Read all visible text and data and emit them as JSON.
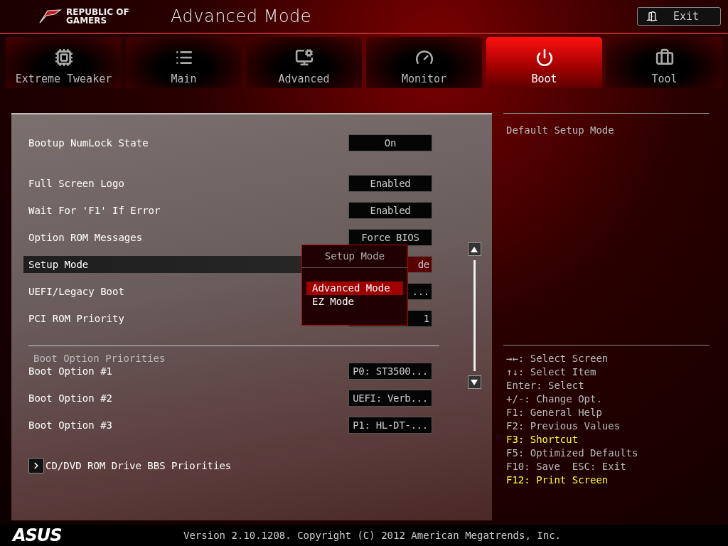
{
  "header": {
    "brand": "REPUBLIC OF GAMERS",
    "title": "Advanced Mode",
    "exit_button": "Exit"
  },
  "tabs": [
    {
      "label": "Extreme Tweaker",
      "selected": false
    },
    {
      "label": "Main",
      "selected": false
    },
    {
      "label": "Advanced",
      "selected": false
    },
    {
      "label": "Monitor",
      "selected": false
    },
    {
      "label": "Boot",
      "selected": true
    },
    {
      "label": "Tool",
      "selected": false
    }
  ],
  "settings": {
    "groups": [
      {
        "items": [
          {
            "kind": "option",
            "label": "Bootup NumLock State",
            "value": "On",
            "selected": false
          }
        ]
      },
      {
        "items": [
          {
            "kind": "option",
            "label": "Full Screen Logo",
            "value": "Enabled",
            "selected": false
          },
          {
            "kind": "option",
            "label": "Wait For 'F1' If Error",
            "value": "Enabled",
            "selected": false
          },
          {
            "kind": "option",
            "label": "Option ROM Messages",
            "value": "Force BIOS",
            "selected": false
          },
          {
            "kind": "option",
            "label": "Setup Mode",
            "value": "de",
            "selected": true,
            "covered": true
          },
          {
            "kind": "option",
            "label": "UEFI/Legacy Boot",
            "value": "...",
            "selected": false,
            "covered": true
          },
          {
            "kind": "option",
            "label": "PCI ROM Priority",
            "value": "1",
            "selected": false,
            "covered": true
          }
        ]
      },
      {
        "heading": "Boot Option Priorities",
        "items": [
          {
            "kind": "option",
            "label": "Boot Option #1",
            "value": "P0: ST3500...",
            "selected": false
          },
          {
            "kind": "option",
            "label": "Boot Option #2",
            "value": "UEFI: Verb...",
            "selected": false
          },
          {
            "kind": "option",
            "label": "Boot Option #3",
            "value": "P1: HL-DT-...",
            "selected": false
          }
        ]
      },
      {
        "items": [
          {
            "kind": "submenu",
            "label": "CD/DVD ROM Drive BBS Priorities",
            "selected": false
          }
        ]
      }
    ]
  },
  "popup": {
    "title": "Setup Mode",
    "options": [
      {
        "label": "Advanced Mode",
        "selected": true
      },
      {
        "label": "EZ Mode",
        "selected": false
      }
    ]
  },
  "help": {
    "description": "Default Setup Mode",
    "keys": [
      {
        "text": "→←: Select Screen",
        "highlight": false
      },
      {
        "text": "↑↓: Select Item",
        "highlight": false
      },
      {
        "text": "Enter: Select",
        "highlight": false
      },
      {
        "text": "+/-: Change Opt.",
        "highlight": false
      },
      {
        "text": "F1: General Help",
        "highlight": false
      },
      {
        "text": "F2: Previous Values",
        "highlight": false
      },
      {
        "text": "F3: Shortcut",
        "highlight": true
      },
      {
        "text": "F5: Optimized Defaults",
        "highlight": false
      },
      {
        "text": "F10: Save  ESC: Exit",
        "highlight": false
      },
      {
        "text": "F12: Print Screen",
        "highlight": true
      }
    ]
  },
  "footer": {
    "logo": "ASUS",
    "version": "Version 2.10.1208. Copyright (C) 2012 American Megatrends, Inc."
  }
}
